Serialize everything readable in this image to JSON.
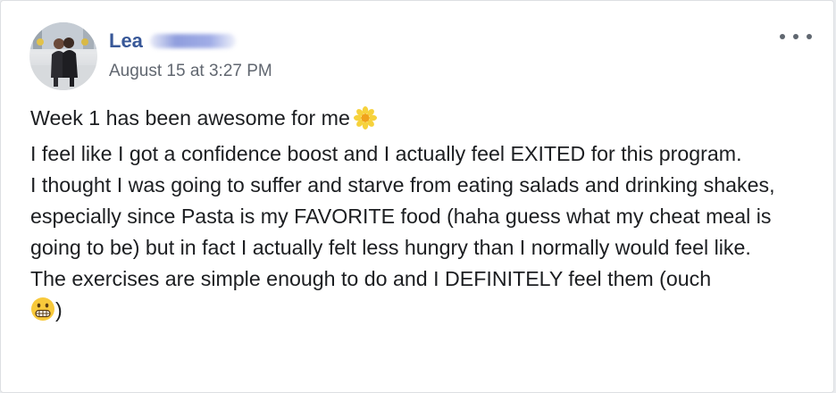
{
  "post": {
    "author": "Lea",
    "timestamp": "August 15 at 3:27 PM",
    "more_icon": "more-horizontal-icon",
    "lines": {
      "l1": "Week 1 has been awesome for me",
      "l2": "I feel like I got a confidence boost and I actually feel EXITED for this program.",
      "l3": "I thought I was going to suffer and starve from eating salads and drinking shakes, especially since Pasta is my FAVORITE food (haha guess what my cheat meal is going to be) but in fact I actually felt less hungry than I normally would feel like.",
      "l4a": "The exercises are simple enough to do and I DEFINITELY feel them (ouch",
      "l4b": ")"
    },
    "emojis": {
      "flower": "blossom-emoji",
      "grimace": "grimacing-face-emoji"
    }
  }
}
